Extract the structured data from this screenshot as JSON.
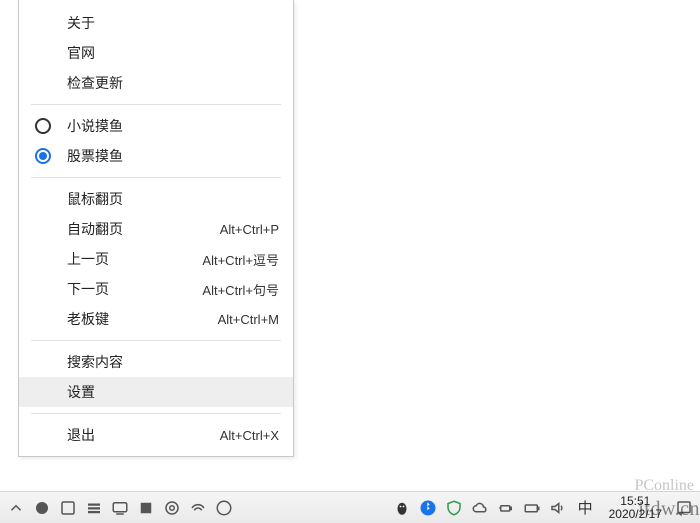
{
  "menu": {
    "section1": [
      {
        "label": "关于"
      },
      {
        "label": "官网"
      },
      {
        "label": "检查更新"
      }
    ],
    "modes": [
      {
        "label": "小说摸鱼",
        "selected": false
      },
      {
        "label": "股票摸鱼",
        "selected": true
      }
    ],
    "navigation": [
      {
        "label": "鼠标翻页",
        "shortcut": ""
      },
      {
        "label": "自动翻页",
        "shortcut": "Alt+Ctrl+P"
      },
      {
        "label": "上一页",
        "shortcut": "Alt+Ctrl+逗号"
      },
      {
        "label": "下一页",
        "shortcut": "Alt+Ctrl+句号"
      },
      {
        "label": "老板键",
        "shortcut": "Alt+Ctrl+M"
      }
    ],
    "tools": [
      {
        "label": "搜索内容"
      },
      {
        "label": "设置",
        "hovered": true
      }
    ],
    "exit": {
      "label": "退出",
      "shortcut": "Alt+Ctrl+X"
    }
  },
  "taskbar": {
    "ime": "中",
    "time": "15:51",
    "date": "2020/2/17"
  },
  "watermark_top": "PConline",
  "watermark": "itdw.cn"
}
